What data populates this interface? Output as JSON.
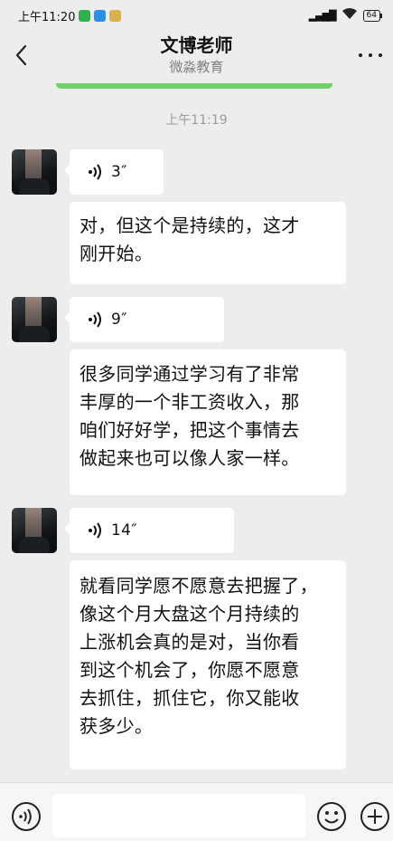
{
  "status_bar": {
    "time": "上午11:20",
    "network": "4G",
    "battery": "64"
  },
  "header": {
    "title": "文博老师",
    "subtitle": "微淼教育"
  },
  "chat": {
    "timestamp": "上午11:19",
    "messages": [
      {
        "type": "voice",
        "duration": "3″"
      },
      {
        "type": "text",
        "lines": [
          "对，但这个是持续的，这才",
          "刚开始。"
        ]
      },
      {
        "type": "voice",
        "duration": "9″"
      },
      {
        "type": "text",
        "lines": [
          "很多同学通过学习有了非常",
          "丰厚的一个非工资收入，那",
          "咱们好好学，把这个事情去",
          "做起来也可以像人家一样。"
        ]
      },
      {
        "type": "voice",
        "duration": "14″"
      },
      {
        "type": "text",
        "lines": [
          "就看同学愿不愿意去把握了，",
          "像这个月大盘这个月持续的",
          "上涨机会真的是对，当你看",
          "到这个机会了，你愿不愿意",
          "去抓住，抓住它，你又能收",
          "获多少。"
        ]
      }
    ]
  },
  "input_bar": {
    "placeholder": ""
  }
}
